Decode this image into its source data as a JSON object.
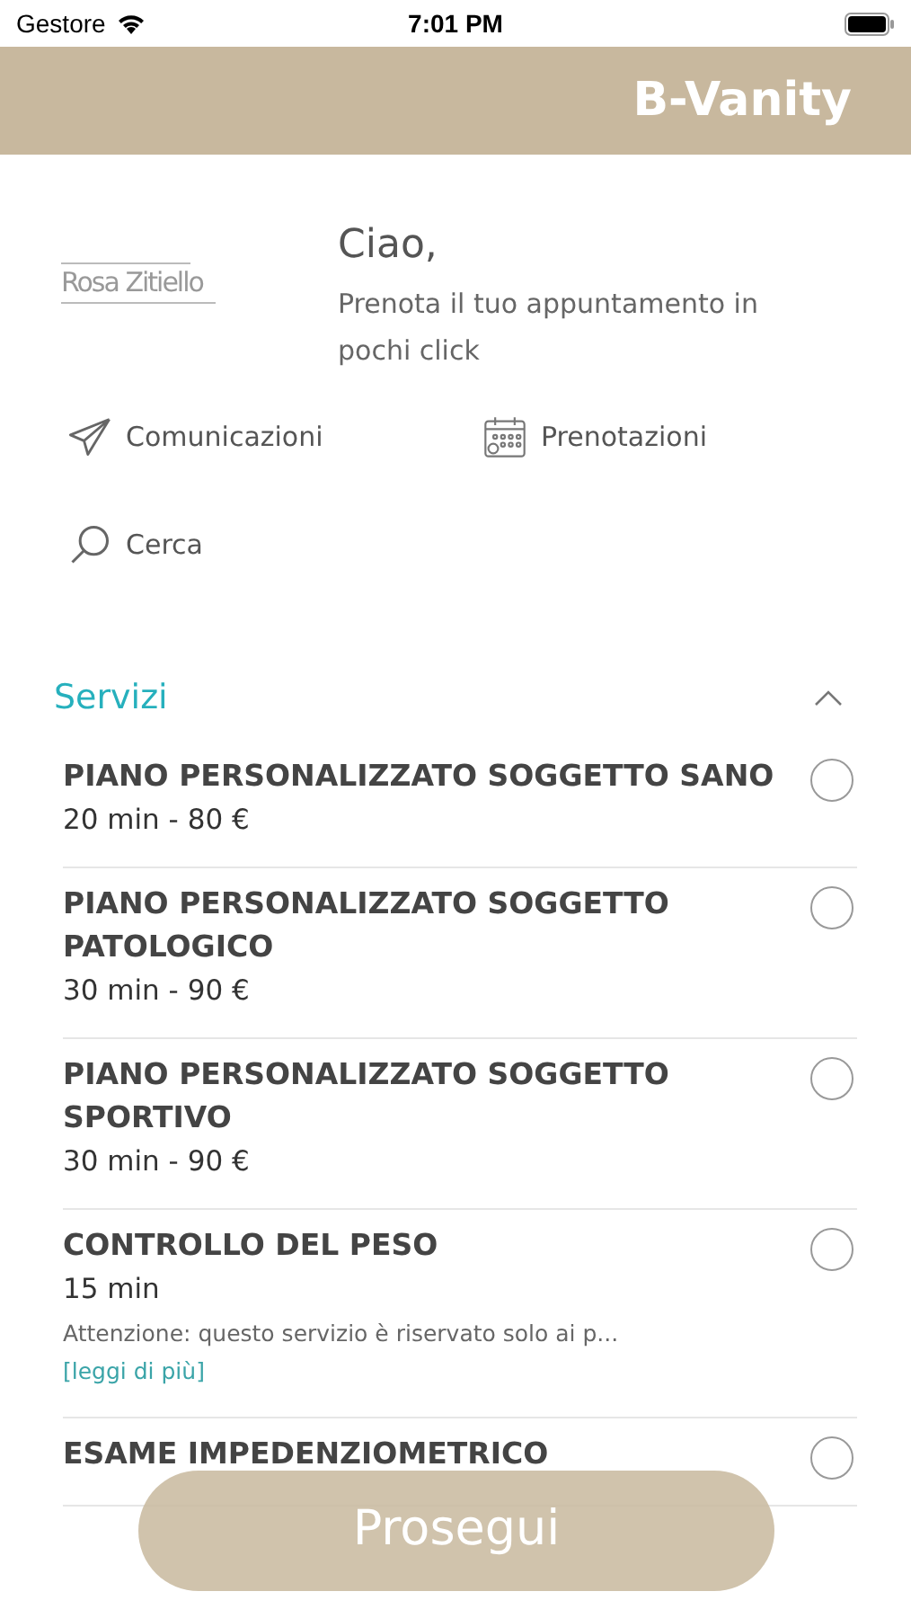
{
  "status_bar": {
    "carrier": "Gestore",
    "time": "7:01 PM"
  },
  "header": {
    "title": "B-Vanity"
  },
  "logo": {
    "name": "Rosa Zitiello"
  },
  "greeting": {
    "title": "Ciao,",
    "subtitle": "Prenota il tuo appuntamento in pochi click"
  },
  "shortcuts": [
    {
      "kind": "send",
      "label": "Comunicazioni"
    },
    {
      "kind": "calendar",
      "label": "Prenotazioni"
    },
    {
      "kind": "search",
      "label": "Cerca"
    }
  ],
  "section": {
    "title": "Servizi",
    "expanded": true
  },
  "services": [
    {
      "title": "PIANO PERSONALIZZATO SOGGETTO SANO",
      "detail": "20 min - 80 €",
      "selected": false
    },
    {
      "title": "PIANO PERSONALIZZATO SOGGETTO PATOLOGICO",
      "detail": "30 min - 90 €",
      "selected": false
    },
    {
      "title": "PIANO PERSONALIZZATO SOGGETTO SPORTIVO",
      "detail": "30 min - 90 €",
      "selected": false
    },
    {
      "title": "CONTROLLO DEL PESO",
      "detail": "15 min",
      "note": "Attenzione: questo servizio è riservato solo ai p...",
      "link": "[leggi di più]",
      "selected": false
    },
    {
      "title": "ESAME IMPEDENZIOMETRICO",
      "selected": false
    }
  ],
  "button": {
    "label": "Prosegui"
  }
}
